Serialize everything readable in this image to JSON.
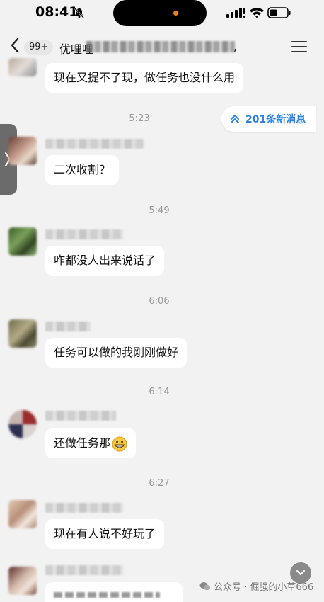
{
  "status_bar": {
    "time": "08:41"
  },
  "nav": {
    "unread_count": "99+",
    "title": "优哩哩",
    "title_trailing": ","
  },
  "new_messages": {
    "label": "201条新消息"
  },
  "messages": [
    {
      "text": "现在又提不了现，做任务也没什么用"
    },
    {
      "timestamp": "5:23",
      "text": "二次收割？"
    },
    {
      "timestamp": "5:49",
      "text": "咋都没人出来说话了"
    },
    {
      "timestamp": "6:06",
      "text": "任务可以做的我刚刚做好"
    },
    {
      "timestamp": "6:14",
      "text": "还做任务那"
    },
    {
      "timestamp": "6:27",
      "text": "现在有人说不好玩了"
    }
  ],
  "watermark": {
    "text": "公众号 · 倔强的小草666"
  },
  "colors": {
    "accent_blue": "#2b83e0",
    "background": "#f2f2f2",
    "bubble": "#ffffff"
  }
}
